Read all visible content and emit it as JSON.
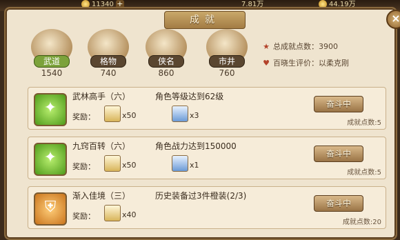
{
  "topbar": {
    "res1": "11340",
    "res2": "7.81万",
    "res3": "44.19万"
  },
  "panel": {
    "title": "成就",
    "close": "×"
  },
  "categories": [
    {
      "label": "武道",
      "count": "1540",
      "active": true
    },
    {
      "label": "格物",
      "count": "740",
      "active": false
    },
    {
      "label": "侠名",
      "count": "860",
      "active": false
    },
    {
      "label": "市井",
      "count": "760",
      "active": false
    }
  ],
  "summary": {
    "total_label": "总成就点数：",
    "total_value": "3900",
    "rating_label": "百晓生评价：",
    "rating_value": "以柔克刚"
  },
  "achievements": [
    {
      "name": "武林高手（六）",
      "desc": "角色等级达到62级",
      "reward_label": "奖励：",
      "reward1_qty": "x50",
      "reward2_qty": "x3",
      "button": "奋斗中",
      "points": "成就点数:5"
    },
    {
      "name": "九窍百转（六）",
      "desc": "角色战力达到150000",
      "reward_label": "奖励：",
      "reward1_qty": "x50",
      "reward2_qty": "x1",
      "button": "奋斗中",
      "points": "成就点数:5"
    },
    {
      "name": "渐入佳境（三）",
      "desc": "历史装备过3件橙装(2/3)",
      "reward_label": "奖励：",
      "reward1_qty": "x40",
      "button": "奋斗中",
      "points": "成就点数:20"
    }
  ],
  "colors": {
    "accent_green": "#7ca23a",
    "panel_bg": "#efe4cf",
    "frame": "#8a6a3e"
  }
}
